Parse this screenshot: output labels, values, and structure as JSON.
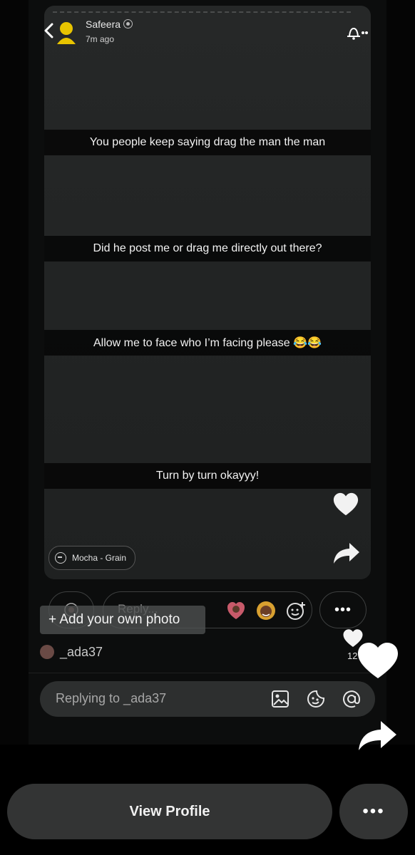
{
  "story": {
    "username": "Safeera",
    "time": "7m ago",
    "captions": [
      "You people keep saying drag the man the man",
      "Did he post me or drag me directly out there?",
      "Allow me to face who I’m facing please 😂😂",
      "Turn by turn okayyy!"
    ],
    "filter_label": "Mocha - Grain"
  },
  "reply_bar": {
    "placeholder": "Reply...",
    "add_photo": "+ Add your own photo"
  },
  "comment": {
    "author": "_ada37",
    "like_count": "12"
  },
  "reply_field": {
    "placeholder": "Replying to _ada37"
  },
  "actions": {
    "view_profile": "View Profile",
    "more": "•••"
  },
  "icons": [
    "back-icon",
    "avatar-icon",
    "verified-badge-icon",
    "bell-icon",
    "heart-icon",
    "share-icon",
    "filter-icon",
    "camera-icon",
    "emoji-icon",
    "add-emoji-icon",
    "more-icon",
    "image-icon",
    "sticker-icon",
    "mention-icon"
  ]
}
